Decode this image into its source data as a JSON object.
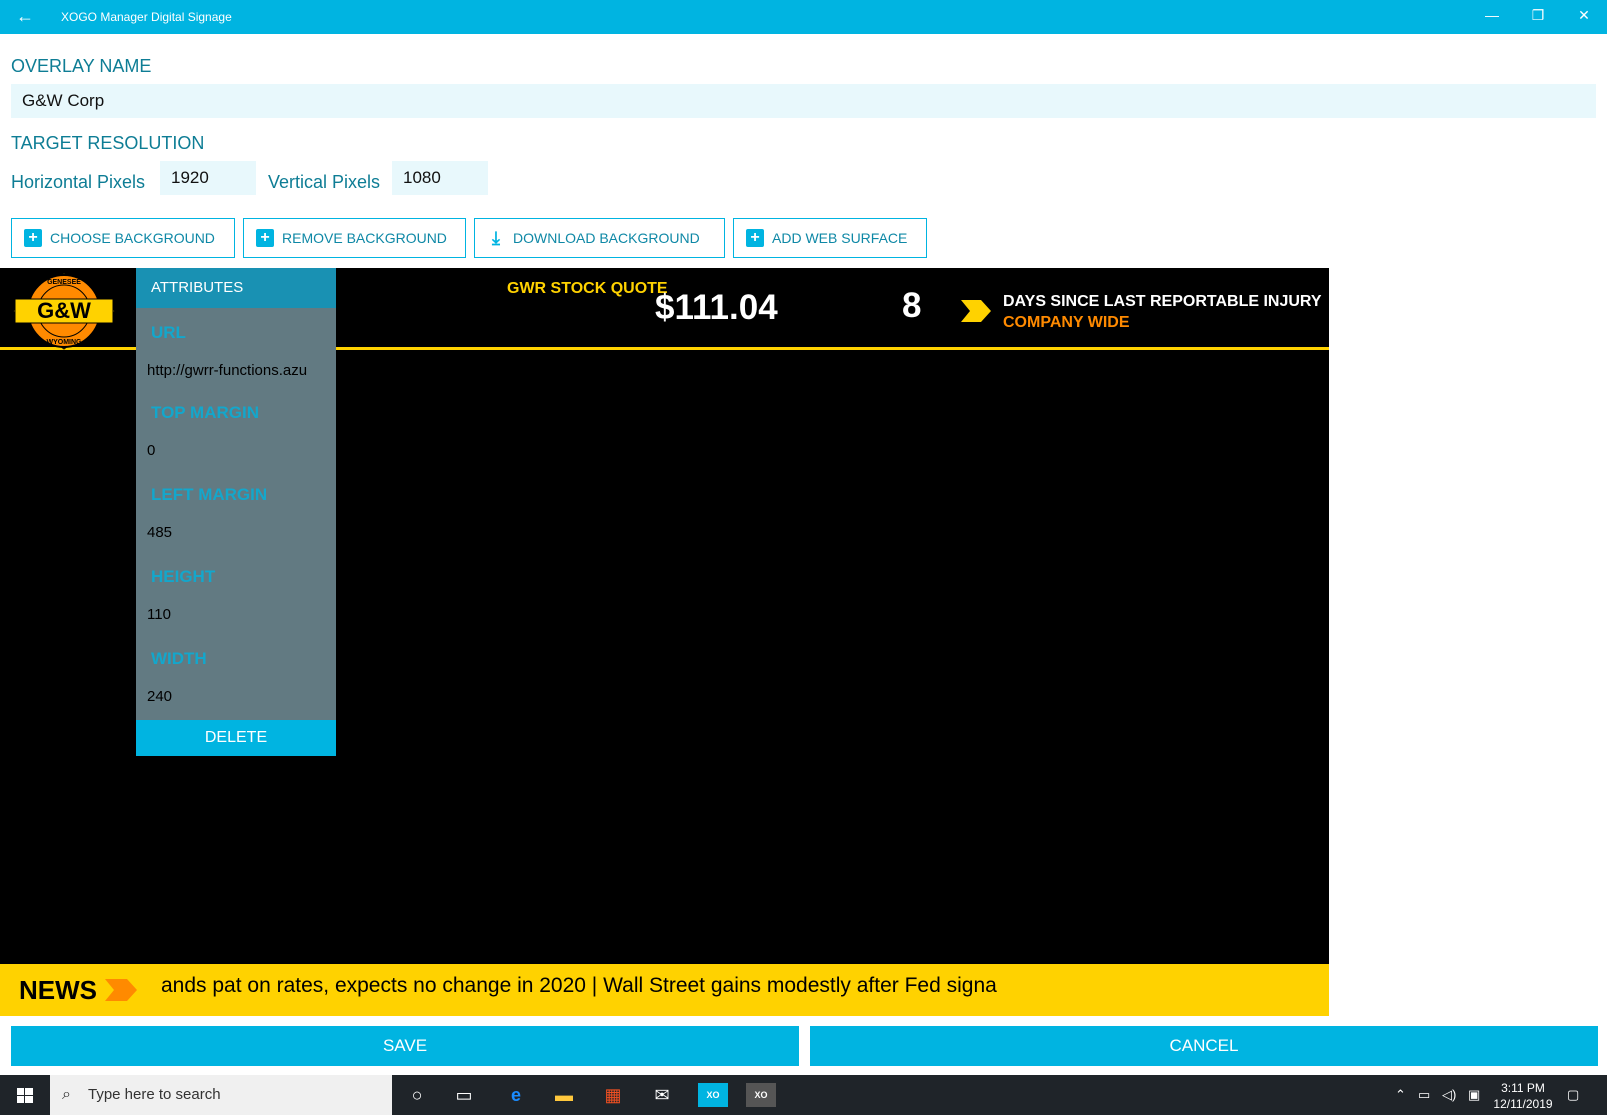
{
  "window": {
    "title": "XOGO Manager Digital Signage",
    "back_glyph": "←",
    "minimize_glyph": "—",
    "restore_glyph": "❐",
    "close_glyph": "✕"
  },
  "form": {
    "overlay_name_label": "OVERLAY NAME",
    "overlay_name_value": "G&W Corp",
    "target_resolution_label": "TARGET RESOLUTION",
    "horizontal_label": "Horizontal Pixels",
    "horizontal_value": "1920",
    "vertical_label": "Vertical Pixels",
    "vertical_value": "1080"
  },
  "toolbar": {
    "choose_background": "CHOOSE BACKGROUND",
    "remove_background": "REMOVE BACKGROUND",
    "download_background": "DOWNLOAD BACKGROUND",
    "add_web_surface": "ADD WEB SURFACE"
  },
  "overlay": {
    "logo_text": "G&W",
    "logo_top_text": "GENESEE",
    "logo_bottom_text": "WYOMING",
    "stock_label": "GWR STOCK QUOTE",
    "stock_price": "$111.04",
    "days_count": "8",
    "injury_text": "DAYS SINCE LAST REPORTABLE INJURY",
    "company_text": "COMPANY WIDE",
    "news_label": "NEWS",
    "news_ticker": "ands pat on rates, expects no change in 2020 | Wall Street gains modestly after Fed signa"
  },
  "attributes": {
    "header": "ATTRIBUTES",
    "url_label": "URL",
    "url_value": "http://gwrr-functions.azu",
    "top_margin_label": "TOP MARGIN",
    "top_margin_value": "0",
    "left_margin_label": "LEFT MARGIN",
    "left_margin_value": "485",
    "height_label": "HEIGHT",
    "height_value": "110",
    "width_label": "WIDTH",
    "width_value": "240",
    "delete_label": "DELETE"
  },
  "actions": {
    "save": "SAVE",
    "cancel": "CANCEL"
  },
  "taskbar": {
    "search_placeholder": "Type here to search",
    "time": "3:11 PM",
    "date": "12/11/2019"
  },
  "colors": {
    "accent": "#00b4e1",
    "label_teal": "#0e7d95",
    "overlay_yellow": "#ffd200",
    "overlay_orange": "#ff8a00"
  }
}
